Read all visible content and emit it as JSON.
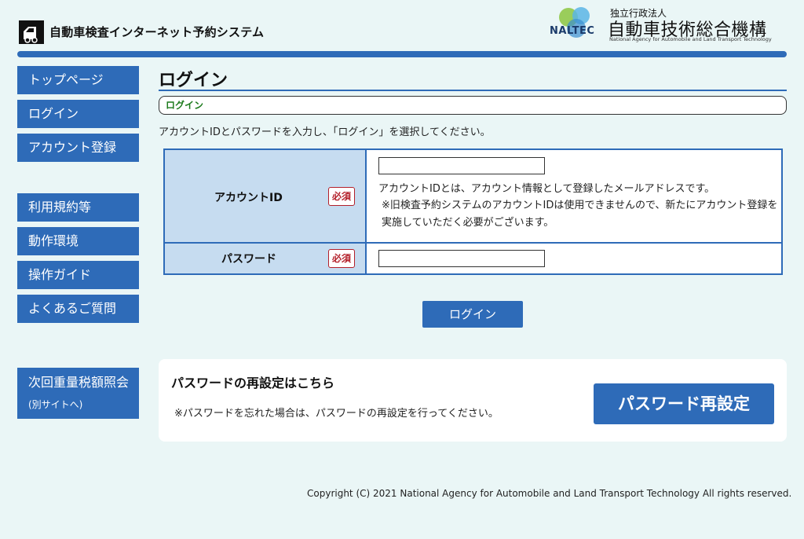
{
  "header": {
    "system_title": "自動車検査インターネット予約システム",
    "org_abbr": "NALTEC",
    "org_type": "独立行政法人",
    "org_name": "自動車技術総合機構",
    "org_name_en": "National Agency for Automobile and Land Transport Technology"
  },
  "sidebar": {
    "group1": [
      {
        "label": "トップページ"
      },
      {
        "label": "ログイン"
      },
      {
        "label": "アカウント登録"
      }
    ],
    "group2": [
      {
        "label": "利用規約等"
      },
      {
        "label": "動作環境"
      },
      {
        "label": "操作ガイド"
      },
      {
        "label": "よくあるご質問"
      }
    ],
    "external": {
      "label": "次回重量税額照会",
      "sub": "(別サイトへ)"
    }
  },
  "main": {
    "title": "ログイン",
    "breadcrumb": "ログイン",
    "instruction": "アカウントIDとパスワードを入力し、「ログイン」を選択してください。",
    "form": {
      "account_id_label": "アカウントID",
      "required_badge": "必須",
      "account_id_value": "",
      "account_id_help": "アカウントIDとは、アカウント情報として登録したメールアドレスです。",
      "account_id_note": "※旧検査予約システムのアカウントIDは使用できませんので、新たにアカウント登録を実施していただく必要がございます。",
      "password_label": "パスワード",
      "password_value": ""
    },
    "login_button": "ログイン",
    "reset": {
      "title": "パスワードの再設定はこちら",
      "note": "※パスワードを忘れた場合は、パスワードの再設定を行ってください。",
      "button": "パスワード再設定"
    }
  },
  "footer": {
    "copyright": "Copyright (C) 2021 National Agency for Automobile and Land Transport Technology All rights reserved."
  },
  "colors": {
    "accent": "#2e6bb8",
    "background": "#eaf6f6",
    "label_cell": "#c6dcf0",
    "required": "#b3202a",
    "breadcrumb_text": "#1b7a1b"
  }
}
